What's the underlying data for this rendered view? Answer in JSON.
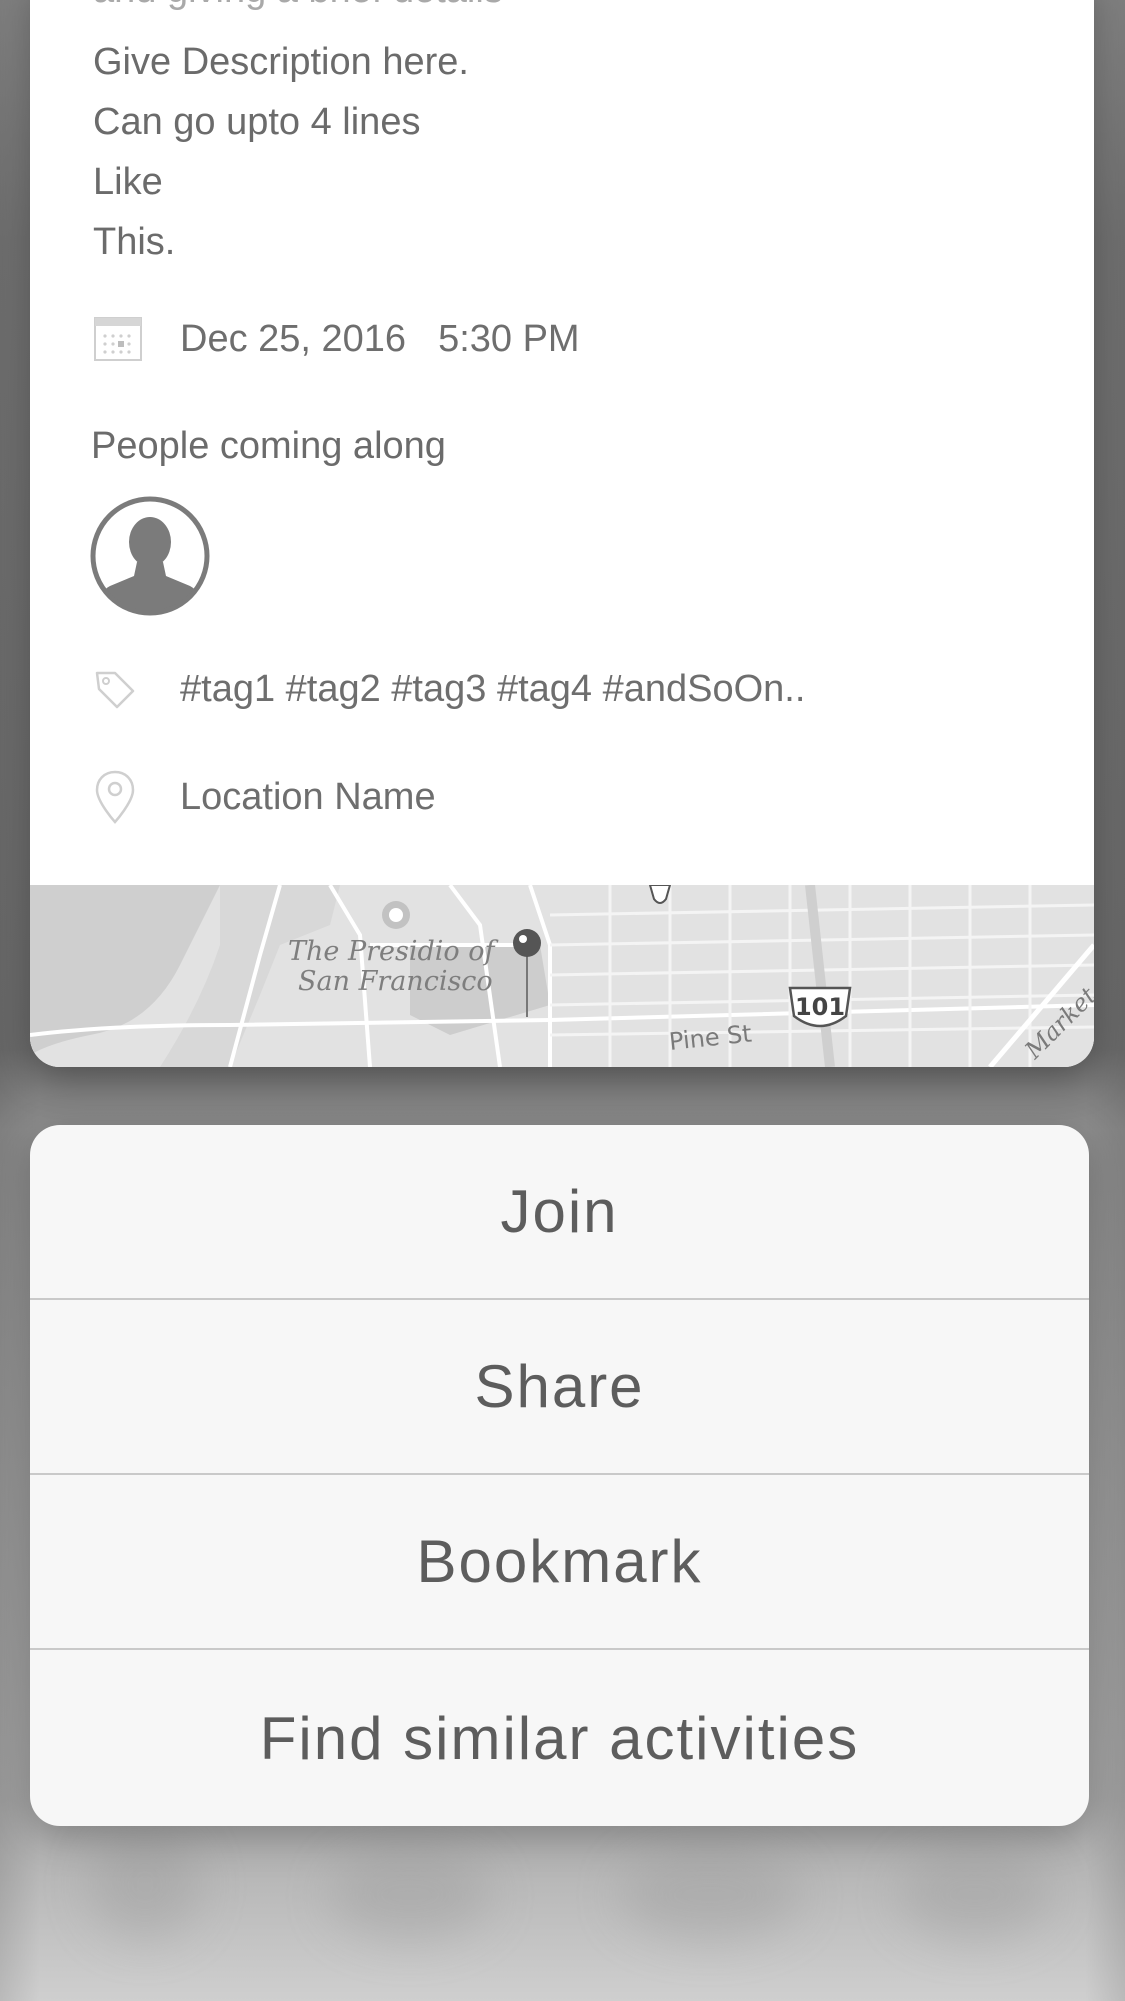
{
  "activity": {
    "clipped_text": "and giving a brief details",
    "description_lines": [
      "Give Description here.",
      "Can go upto 4 lines",
      "Like",
      "This."
    ],
    "date": "Dec 25, 2016",
    "time": "5:30 PM",
    "people_label": "People coming along",
    "tags": "#tag1 #tag2 #tag3 #tag4 #andSoOn..",
    "location": "Location Name"
  },
  "map": {
    "place_line1": "The Presidio of",
    "place_line2": "San Francisco",
    "street": "Pine St",
    "highway": "101",
    "street2": "Market St"
  },
  "action_sheet": {
    "items": [
      "Join",
      "Share",
      "Bookmark",
      "Find similar activities"
    ]
  },
  "icons": {
    "date": "calendar-icon",
    "avatar": "person-avatar-icon",
    "tags": "tag-icon",
    "location": "map-pin-icon"
  },
  "colors": {
    "card_background": "#ffffff",
    "sheet_background": "#f7f7f7",
    "text_primary": "#6b6b6b",
    "sheet_text": "#5d5d5d",
    "divider": "#c9c9c9"
  }
}
